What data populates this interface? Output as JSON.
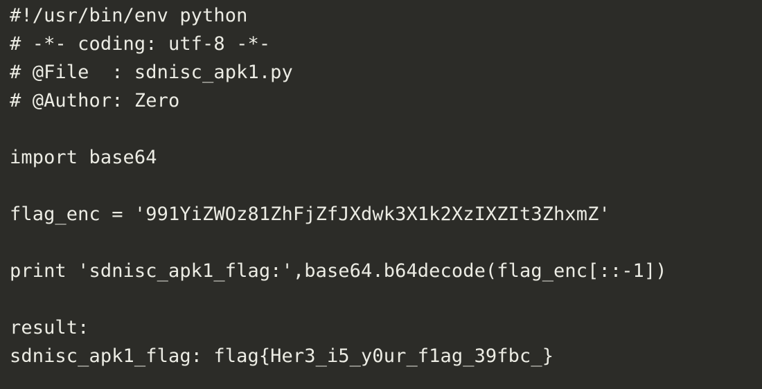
{
  "code_lines": [
    "#!/usr/bin/env python",
    "# -*- coding: utf-8 -*-",
    "# @File  : sdnisc_apk1.py",
    "# @Author: Zero",
    "",
    "import base64",
    "",
    "flag_enc = '991YiZWOz81ZhFjZfJXdwk3X1k2XzIXZIt3ZhxmZ'",
    "",
    "print 'sdnisc_apk1_flag:',base64.b64decode(flag_enc[::-1])",
    "",
    "result:",
    "sdnisc_apk1_flag: flag{Her3_i5_y0ur_f1ag_39fbc_}"
  ],
  "colors": {
    "background": "#2c2c28",
    "text": "#ecece4"
  }
}
